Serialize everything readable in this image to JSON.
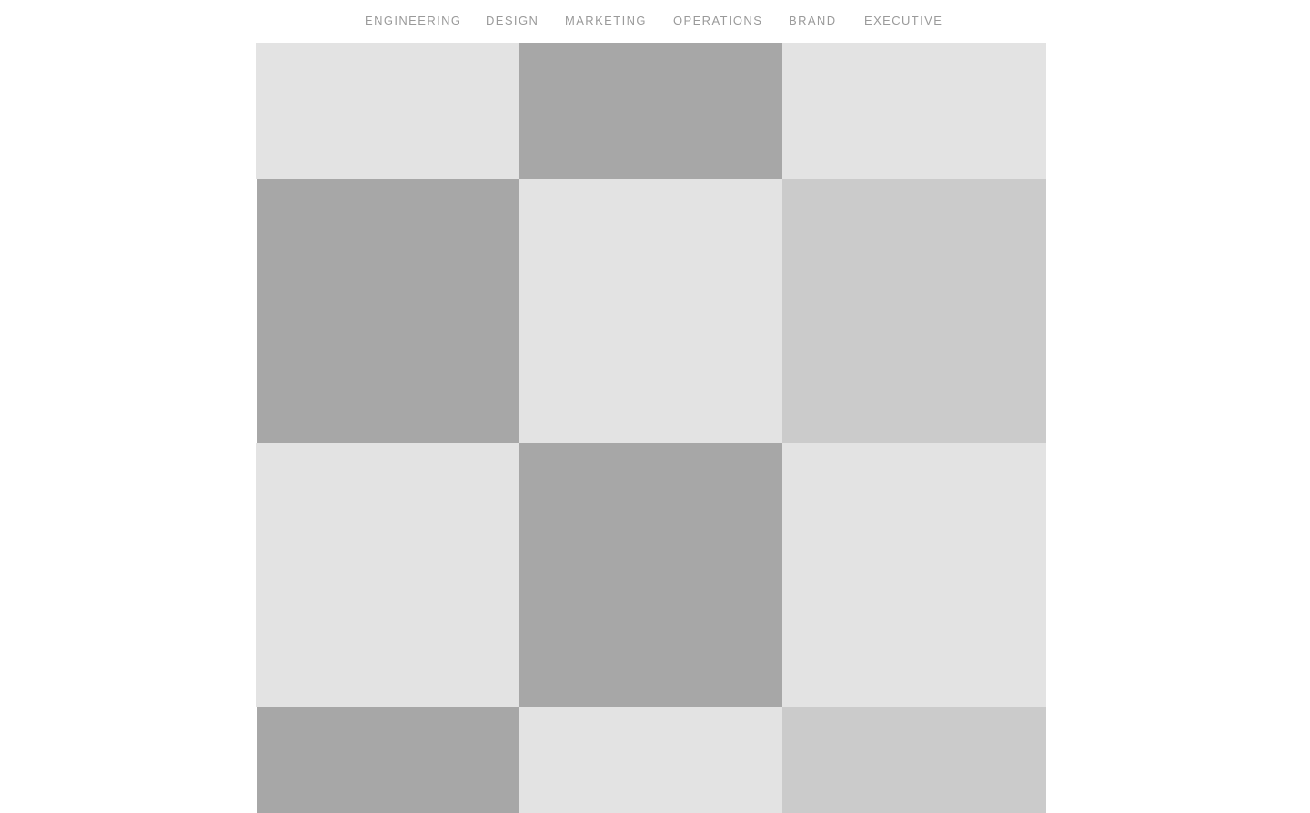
{
  "nav": {
    "items": [
      {
        "label": "ENGINEERING"
      },
      {
        "label": "DESIGN"
      },
      {
        "label": "MARKETING"
      },
      {
        "label": "OPERATIONS"
      },
      {
        "label": "BRAND"
      },
      {
        "label": "EXECUTIVE"
      }
    ]
  },
  "colors": {
    "background": "#ffffff",
    "nav_text": "#9a9a9a",
    "tile_light": "#e3e3e3",
    "tile_dark": "#a7a7a7",
    "tile_mid": "#cbcbcb"
  },
  "grid": {
    "tiles": [
      {
        "tone": "light"
      },
      {
        "tone": "dark"
      },
      {
        "tone": "light"
      },
      {
        "tone": "dark"
      },
      {
        "tone": "light"
      },
      {
        "tone": "mid"
      },
      {
        "tone": "light"
      },
      {
        "tone": "dark"
      },
      {
        "tone": "light"
      },
      {
        "tone": "dark"
      },
      {
        "tone": "light"
      },
      {
        "tone": "mid"
      }
    ]
  }
}
